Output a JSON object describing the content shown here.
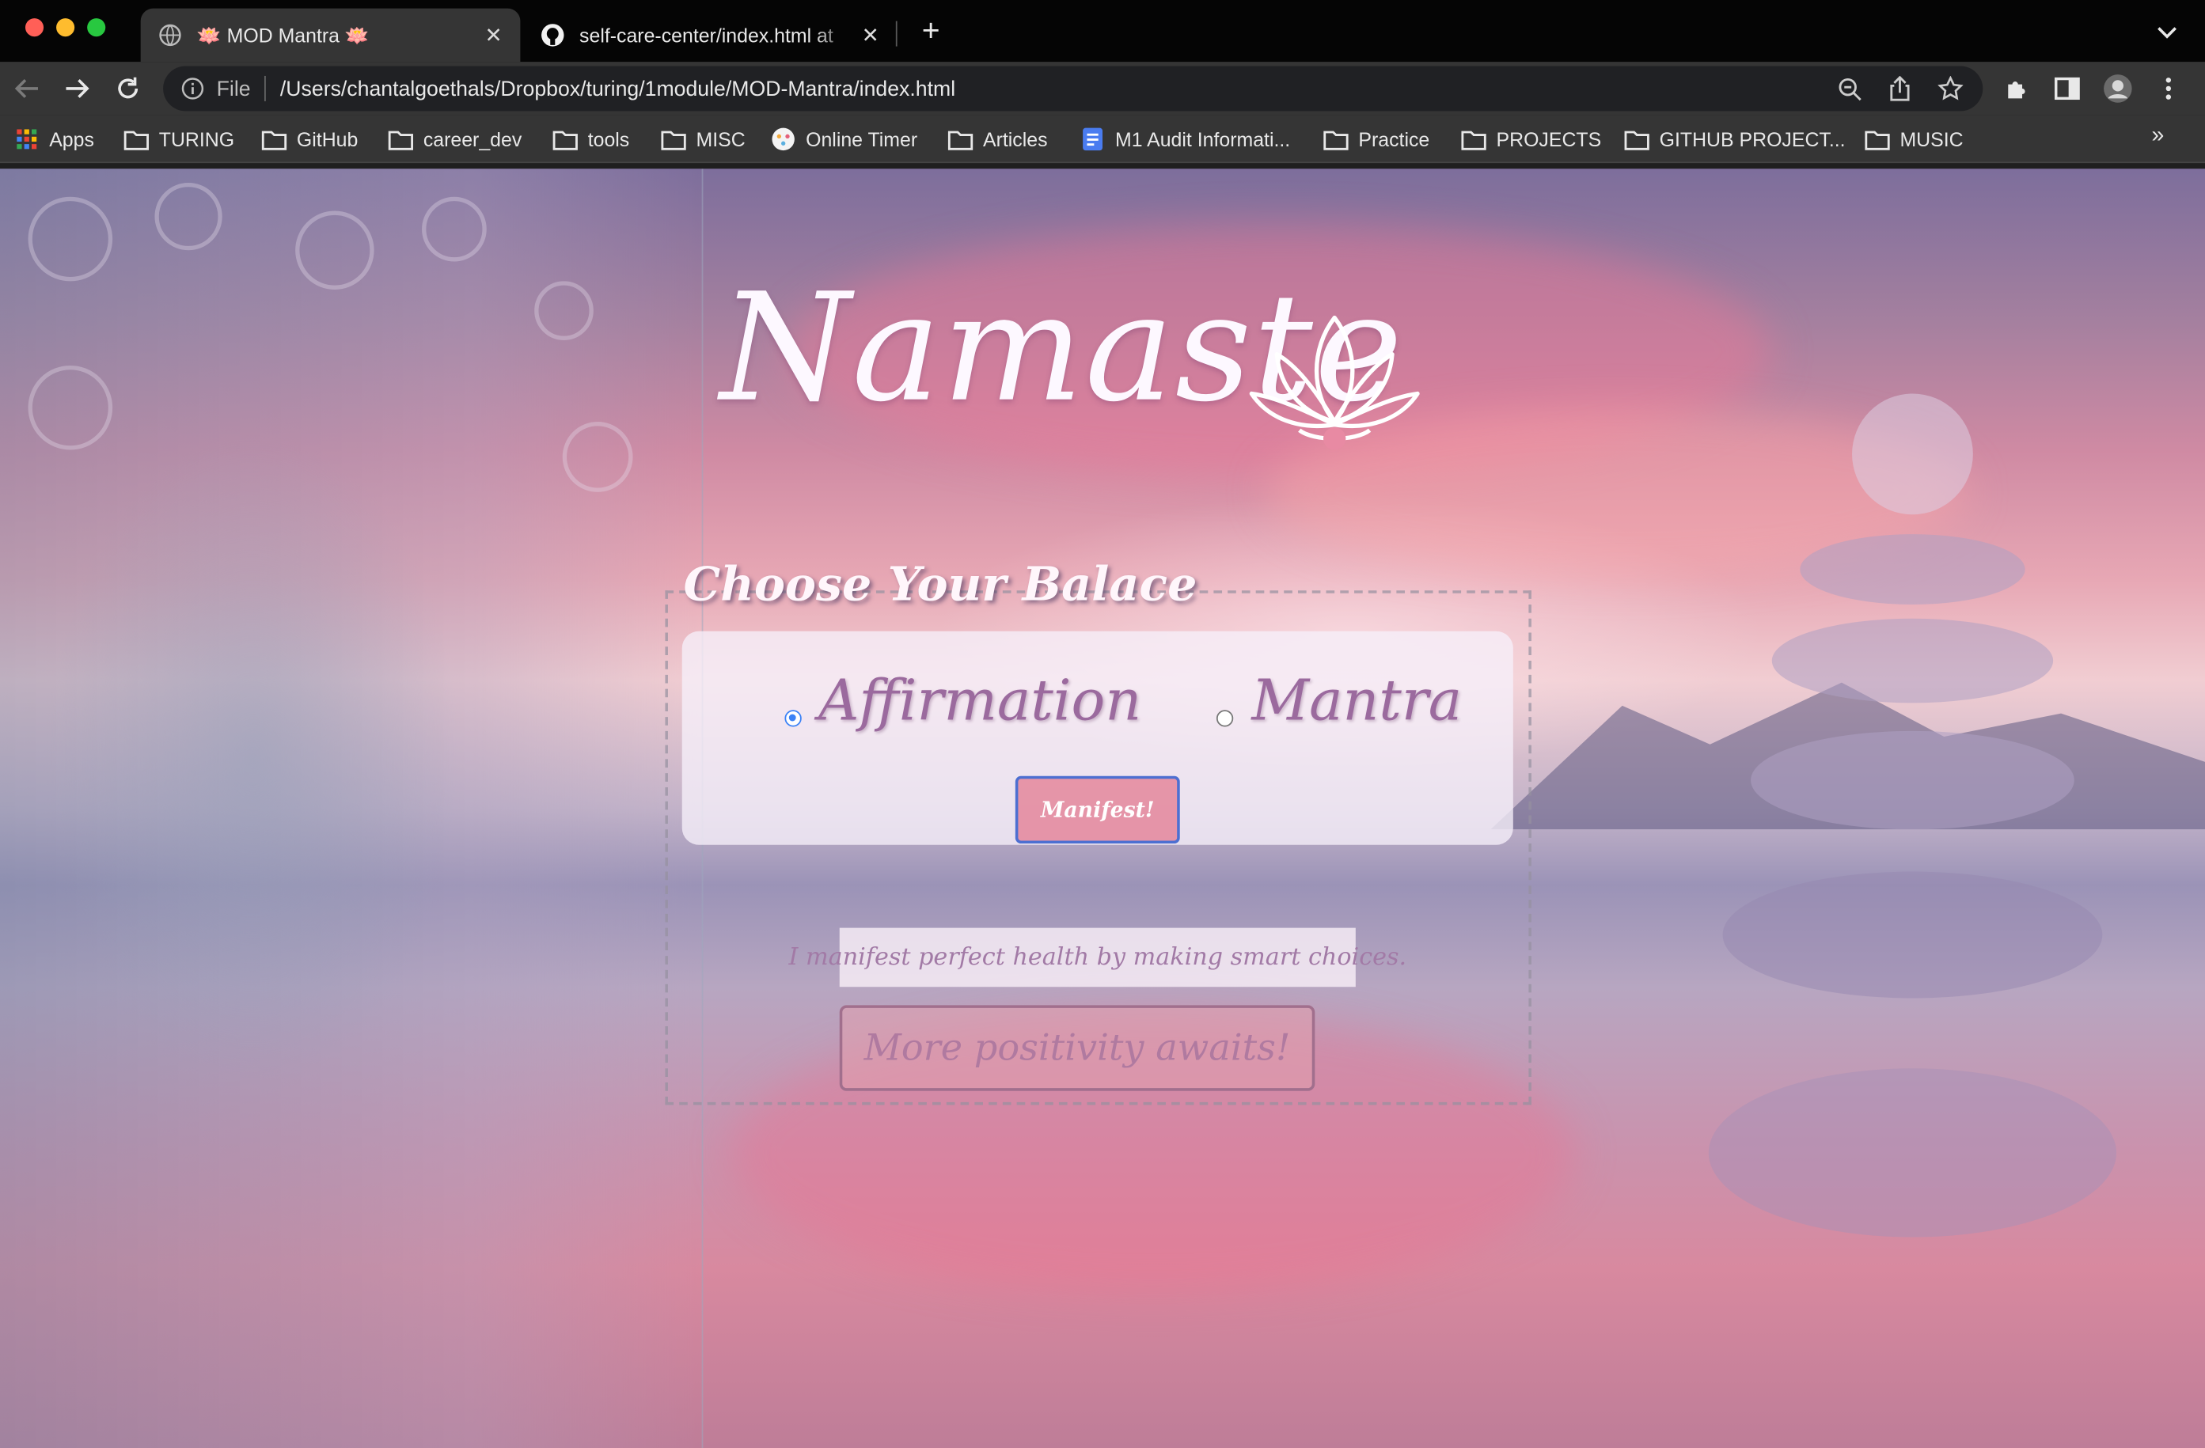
{
  "window": {
    "tabs": [
      {
        "title": "🪷 MOD Mantra 🪷",
        "active": true
      },
      {
        "title": "self-care-center/index.html at",
        "active": false
      }
    ]
  },
  "toolbar": {
    "scheme_label": "File",
    "url": "/Users/chantalgoethals/Dropbox/turing/1module/MOD-Mantra/index.html"
  },
  "bookmarks": {
    "items": [
      {
        "label": "Apps",
        "icon": "apps-grid-icon"
      },
      {
        "label": "TURING",
        "icon": "folder-icon"
      },
      {
        "label": "GitHub",
        "icon": "folder-icon"
      },
      {
        "label": "career_dev",
        "icon": "folder-icon"
      },
      {
        "label": "tools",
        "icon": "folder-icon"
      },
      {
        "label": "MISC",
        "icon": "folder-icon"
      },
      {
        "label": "Online Timer",
        "icon": "timer-icon"
      },
      {
        "label": "Articles",
        "icon": "folder-icon"
      },
      {
        "label": "M1 Audit Informati...",
        "icon": "doc-icon"
      },
      {
        "label": "Practice",
        "icon": "folder-icon"
      },
      {
        "label": "PROJECTS",
        "icon": "folder-icon"
      },
      {
        "label": "GITHUB PROJECT...",
        "icon": "folder-icon"
      },
      {
        "label": "MUSIC",
        "icon": "folder-icon"
      }
    ],
    "more": "»"
  },
  "page": {
    "title": "Namaste",
    "chooser_heading": "Choose Your Balace",
    "options": [
      {
        "label": "Affirmation",
        "checked": true
      },
      {
        "label": "Mantra",
        "checked": false
      }
    ],
    "manifest_button": "Manifest!",
    "message": "I manifest perfect health by making smart choices.",
    "more_button": "More positivity awaits!"
  },
  "colors": {
    "accent": "#e48ca0",
    "focus_ring": "#4d6fd1",
    "script_text": "#9b6a9e"
  }
}
